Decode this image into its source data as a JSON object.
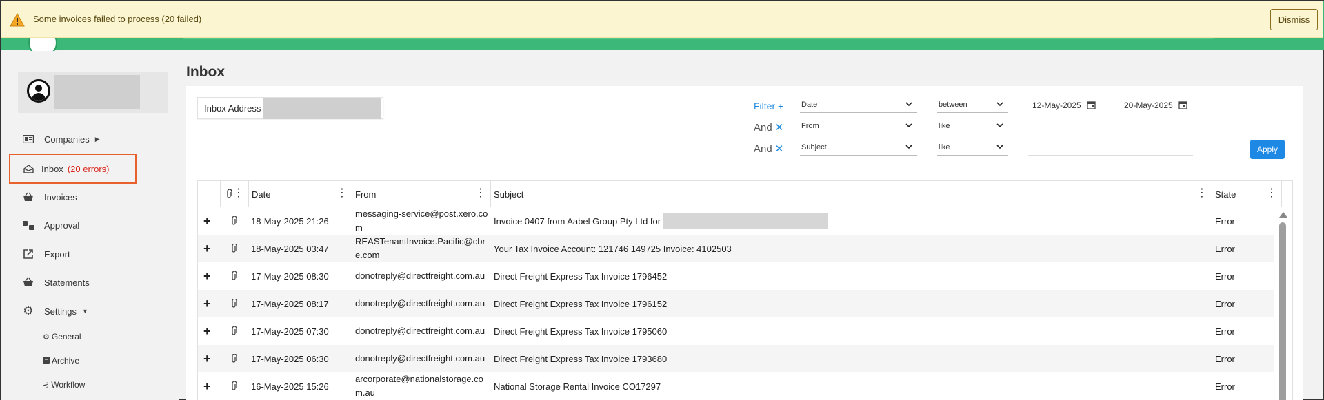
{
  "alert": {
    "message": "Some invoices failed to process (20 failed)",
    "dismiss_label": "Dismiss",
    "icon": "warning-icon",
    "color": "#fcf5d2"
  },
  "sidebar": {
    "items": [
      {
        "label": "Companies",
        "icon": "companies-icon",
        "has_caret": true
      },
      {
        "label": "Inbox",
        "icon": "inbox-icon",
        "badge": "(20 errors)",
        "active": true
      },
      {
        "label": "Invoices",
        "icon": "basket-icon"
      },
      {
        "label": "Approval",
        "icon": "approval-icon"
      },
      {
        "label": "Export",
        "icon": "export-icon"
      },
      {
        "label": "Statements",
        "icon": "basket-icon"
      },
      {
        "label": "Settings",
        "icon": "gear-icon",
        "has_caret": true
      }
    ],
    "sub_items": [
      {
        "label": "General",
        "icon": "gear-icon"
      },
      {
        "label": "Archive",
        "icon": "archive-icon"
      },
      {
        "label": "Workflow",
        "icon": "workflow-icon"
      }
    ]
  },
  "main": {
    "title": "Inbox",
    "inbox_address_label": "Inbox Address",
    "filter": {
      "filter_label": "Filter +",
      "and_label": "And",
      "rows": [
        {
          "field": "Date",
          "operator": "between",
          "value_from": "12-May-2025",
          "value_to": "20-May-2025"
        },
        {
          "field": "From",
          "operator": "like",
          "value": ""
        },
        {
          "field": "Subject",
          "operator": "like",
          "value": ""
        }
      ],
      "apply_label": "Apply"
    },
    "table": {
      "columns": [
        "Date",
        "From",
        "Subject",
        "State"
      ],
      "rows": [
        {
          "date": "18-May-2025 21:26",
          "from": "messaging-service@post.xero.com",
          "subject": "Invoice 0407 from Aabel Group Pty Ltd for",
          "subject_redacted": true,
          "state": "Error"
        },
        {
          "date": "18-May-2025 03:47",
          "from": "REASTenantInvoice.Pacific@cbre.com",
          "subject": "Your Tax Invoice Account: 121746 149725 Invoice: 4102503",
          "state": "Error"
        },
        {
          "date": "17-May-2025 08:30",
          "from": "donotreply@directfreight.com.au",
          "subject": "Direct Freight Express Tax Invoice 1796452",
          "state": "Error"
        },
        {
          "date": "17-May-2025 08:17",
          "from": "donotreply@directfreight.com.au",
          "subject": "Direct Freight Express Tax Invoice 1796152",
          "state": "Error"
        },
        {
          "date": "17-May-2025 07:30",
          "from": "donotreply@directfreight.com.au",
          "subject": "Direct Freight Express Tax Invoice 1795060",
          "state": "Error"
        },
        {
          "date": "17-May-2025 06:30",
          "from": "donotreply@directfreight.com.au",
          "subject": "Direct Freight Express Tax Invoice 1793680",
          "state": "Error"
        },
        {
          "date": "16-May-2025 15:26",
          "from": "arcorporate@nationalstorage.com.au",
          "subject": "National Storage Rental Invoice CO17297",
          "state": "Error"
        }
      ]
    }
  },
  "colors": {
    "header_green": "#3cb878",
    "accent_blue": "#1e88e5",
    "error_red": "#d9261c",
    "active_outline": "#e8602c"
  }
}
